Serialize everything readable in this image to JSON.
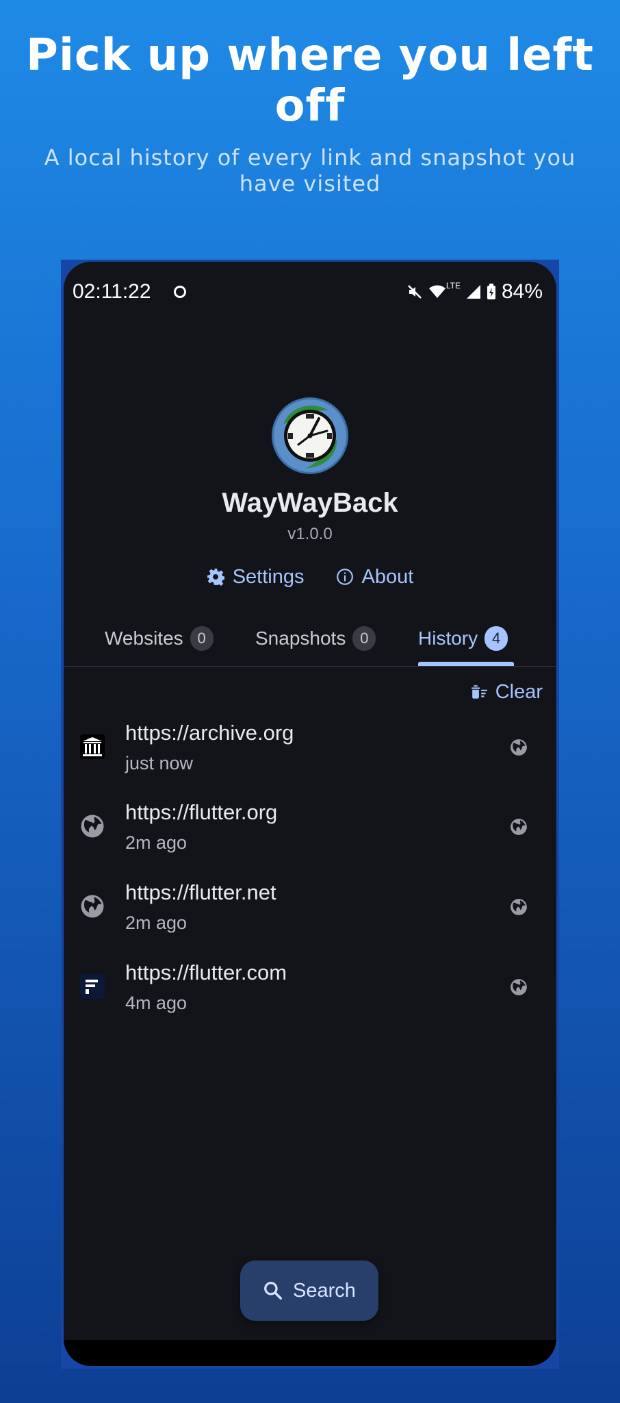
{
  "promo": {
    "headline": "Pick up where you left off",
    "subheadline": "A local history of every link and snapshot you have visited"
  },
  "status_bar": {
    "time": "02:11:22",
    "network": "LTE",
    "battery": "84%"
  },
  "app": {
    "name": "WayWayBack",
    "version": "v1.0.0",
    "logo_icon": "clock-globe-logo"
  },
  "links": {
    "settings": "Settings",
    "about": "About"
  },
  "tabs": [
    {
      "label": "Websites",
      "count": "0",
      "active": false
    },
    {
      "label": "Snapshots",
      "count": "0",
      "active": false
    },
    {
      "label": "History",
      "count": "4",
      "active": true
    }
  ],
  "history": {
    "clear_label": "Clear",
    "items": [
      {
        "url": "https://archive.org",
        "time": "just now",
        "favicon": "archive-icon"
      },
      {
        "url": "https://flutter.org",
        "time": "2m ago",
        "favicon": "globe-icon"
      },
      {
        "url": "https://flutter.net",
        "time": "2m ago",
        "favicon": "globe-icon"
      },
      {
        "url": "https://flutter.com",
        "time": "4m ago",
        "favicon": "flutter-f-icon"
      }
    ]
  },
  "search": {
    "label": "Search"
  },
  "colors": {
    "background_top": "#1f8ae6",
    "background_bottom": "#0d3f94",
    "app_background": "#131419",
    "accent": "#a6c4ff",
    "search_button": "#283f6b"
  }
}
